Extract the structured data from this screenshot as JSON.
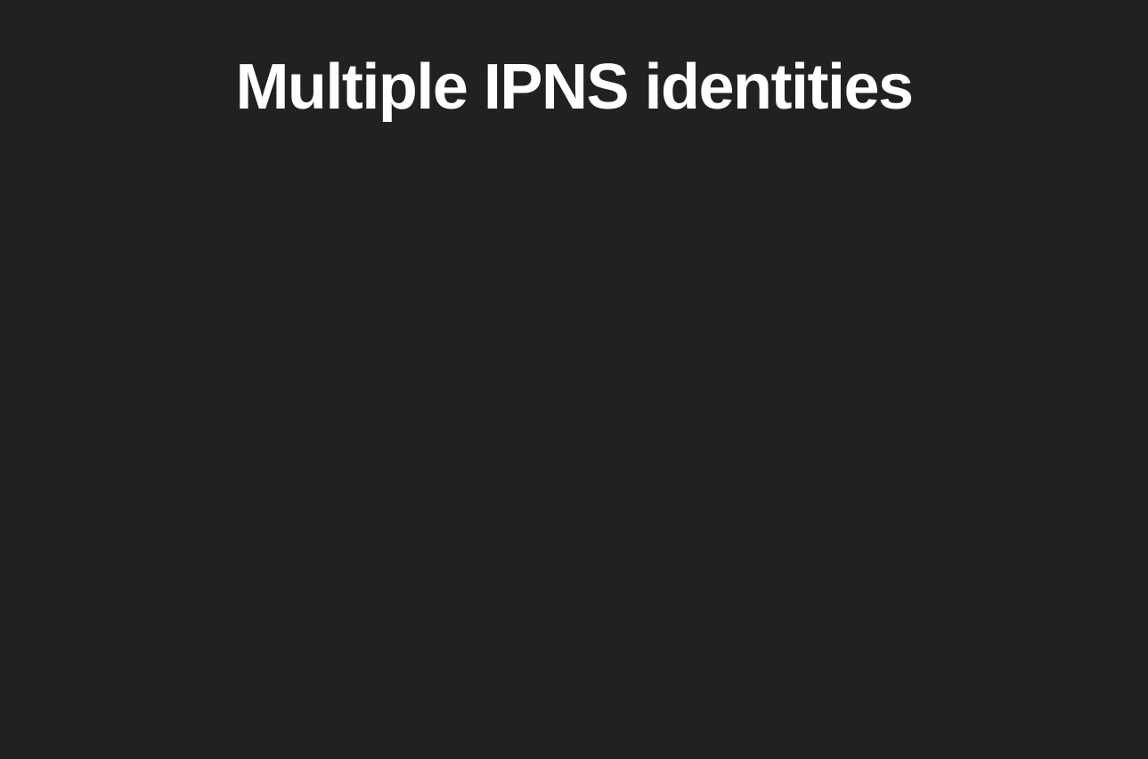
{
  "slide": {
    "title": "Multiple IPNS identities"
  },
  "colors": {
    "background": "#212121",
    "title": "#ffffff"
  }
}
